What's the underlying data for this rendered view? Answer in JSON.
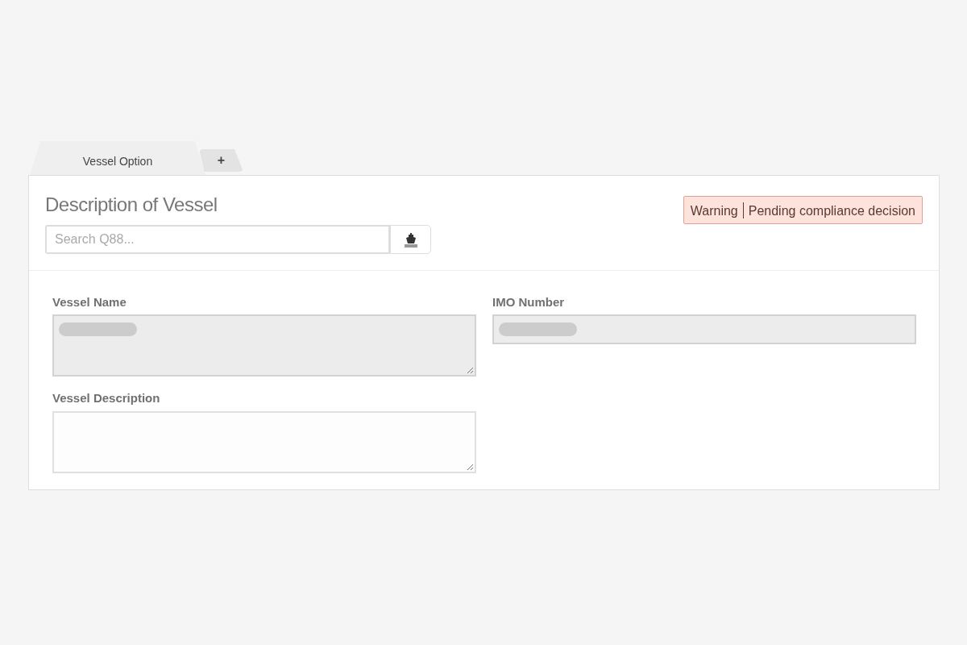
{
  "tabs": [
    {
      "label": "Vessel Option",
      "selected": true
    },
    {
      "label": "+",
      "selected": false
    }
  ],
  "header": {
    "title": "Description of Vessel",
    "search": {
      "placeholder": "Search Q88..."
    },
    "warning": {
      "label": "Warning",
      "message": "Pending compliance decision"
    }
  },
  "fields": [
    {
      "label": "Vessel Name",
      "kind": "textarea",
      "disabled": true,
      "loading": true
    },
    {
      "label": "IMO Number",
      "kind": "input",
      "disabled": true,
      "loading": true
    },
    {
      "label": "Vessel Description",
      "kind": "textarea",
      "disabled": false,
      "loading": false
    }
  ]
}
